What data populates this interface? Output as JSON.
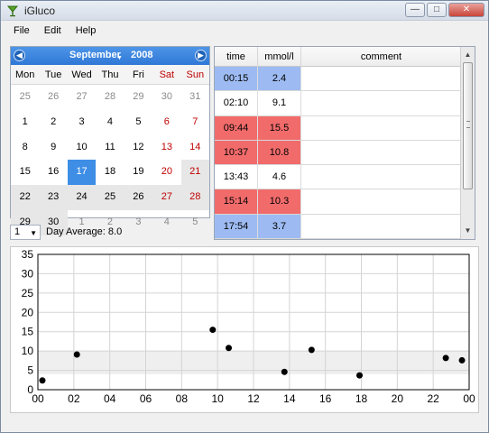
{
  "window": {
    "title": "iGluco"
  },
  "menu": [
    "File",
    "Edit",
    "Help"
  ],
  "calendar": {
    "month": "September",
    "year": "2008",
    "day_headers": [
      "Mon",
      "Tue",
      "Wed",
      "Thu",
      "Fri",
      "Sat",
      "Sun"
    ],
    "weeks": [
      [
        "25",
        "26",
        "27",
        "28",
        "29",
        "30",
        "31"
      ],
      [
        "1",
        "2",
        "3",
        "4",
        "5",
        "6",
        "7"
      ],
      [
        "8",
        "9",
        "10",
        "11",
        "12",
        "13",
        "14"
      ],
      [
        "15",
        "16",
        "17",
        "18",
        "19",
        "20",
        "21"
      ],
      [
        "22",
        "23",
        "24",
        "25",
        "26",
        "27",
        "28"
      ],
      [
        "29",
        "30",
        "1",
        "2",
        "3",
        "4",
        "5"
      ]
    ],
    "selected_day": "17"
  },
  "day_spin": "1",
  "day_average": "Day Average: 8.0",
  "readings_table": {
    "headers": [
      "time",
      "mmol/l",
      "comment"
    ],
    "rows": [
      {
        "time": "00:15",
        "value": "2.4",
        "comment": "",
        "status": "low"
      },
      {
        "time": "02:10",
        "value": "9.1",
        "comment": "",
        "status": "normal"
      },
      {
        "time": "09:44",
        "value": "15.5",
        "comment": "",
        "status": "high"
      },
      {
        "time": "10:37",
        "value": "10.8",
        "comment": "",
        "status": "high"
      },
      {
        "time": "13:43",
        "value": "4.6",
        "comment": "",
        "status": "normal"
      },
      {
        "time": "15:14",
        "value": "10.3",
        "comment": "",
        "status": "high"
      },
      {
        "time": "17:54",
        "value": "3.7",
        "comment": "",
        "status": "low"
      }
    ]
  },
  "colors": {
    "low": "#9dbbf2",
    "high": "#f26b6b",
    "normal": "#ffffff",
    "accent": "#3e8ee6",
    "weekend": "#c00000",
    "target_band": "#efefef"
  },
  "chart_data": {
    "type": "scatter",
    "xlabel": "",
    "ylabel": "",
    "xlim": [
      0,
      24
    ],
    "ylim": [
      0,
      35
    ],
    "x_ticks": [
      "00",
      "02",
      "04",
      "06",
      "08",
      "10",
      "12",
      "14",
      "16",
      "18",
      "20",
      "22",
      "00"
    ],
    "y_ticks": [
      "0",
      "5",
      "10",
      "15",
      "20",
      "25",
      "30",
      "35"
    ],
    "grid": true,
    "target_band": [
      4,
      10
    ],
    "points": [
      {
        "x": 0.25,
        "y": 2.4
      },
      {
        "x": 2.17,
        "y": 9.1
      },
      {
        "x": 9.73,
        "y": 15.5
      },
      {
        "x": 10.62,
        "y": 10.8
      },
      {
        "x": 13.72,
        "y": 4.6
      },
      {
        "x": 15.23,
        "y": 10.3
      },
      {
        "x": 17.9,
        "y": 3.7
      },
      {
        "x": 22.7,
        "y": 8.2
      },
      {
        "x": 23.6,
        "y": 7.6
      }
    ]
  }
}
